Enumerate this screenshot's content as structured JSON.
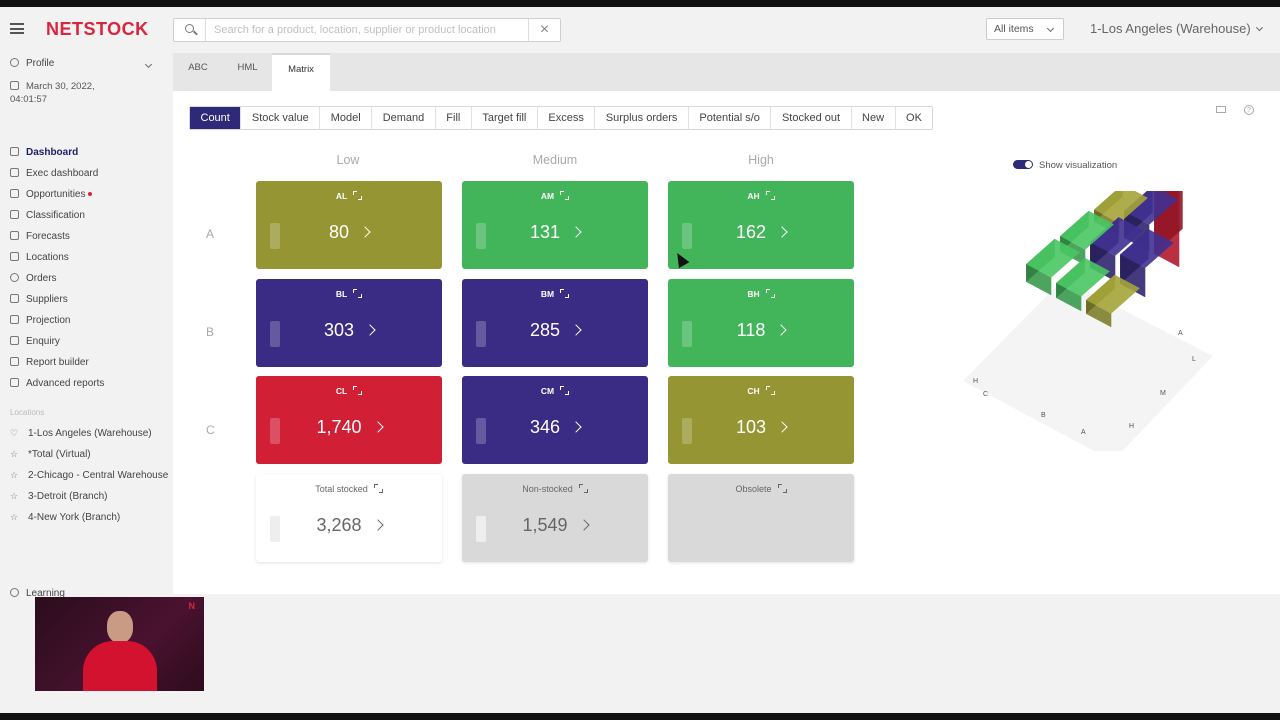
{
  "app": {
    "logo": "NETSTOCK",
    "search_placeholder": "Search for a product, location, supplier or product location",
    "items_filter": "All items",
    "location": "1-Los Angeles (Warehouse)"
  },
  "sidebar": {
    "profile": "Profile",
    "date": "March 30, 2022, 04:01:57",
    "nav": [
      {
        "label": "Dashboard",
        "icon": "chart-bars-icon"
      },
      {
        "label": "Exec dashboard",
        "icon": "grid-icon"
      },
      {
        "label": "Opportunities",
        "icon": "mountain-icon"
      },
      {
        "label": "Classification",
        "icon": "table-icon"
      },
      {
        "label": "Forecasts",
        "icon": "line-chart-icon"
      },
      {
        "label": "Locations",
        "icon": "building-icon"
      },
      {
        "label": "Orders",
        "icon": "orders-icon"
      },
      {
        "label": "Suppliers",
        "icon": "truck-icon"
      },
      {
        "label": "Projection",
        "icon": "projection-icon"
      },
      {
        "label": "Enquiry",
        "icon": "enquiry-icon"
      },
      {
        "label": "Report builder",
        "icon": "report-icon"
      },
      {
        "label": "Advanced reports",
        "icon": "document-icon"
      }
    ],
    "locations_title": "Locations",
    "locations": [
      "1-Los Angeles (Warehouse)",
      "*Total (Virtual)",
      "2-Chicago - Central Warehouse",
      "3-Detroit (Branch)",
      "4-New York (Branch)"
    ],
    "learning": "Learning"
  },
  "tabs": [
    "ABC",
    "HML",
    "Matrix"
  ],
  "metrics": [
    "Count",
    "Stock value",
    "Model",
    "Demand",
    "Fill",
    "Target fill",
    "Excess",
    "Surplus orders",
    "Potential s/o",
    "Stocked out",
    "New",
    "OK"
  ],
  "matrix": {
    "columns": [
      "Low",
      "Medium",
      "High"
    ],
    "rows": [
      "A",
      "B",
      "C"
    ],
    "cells": [
      {
        "code": "AL",
        "value": "80",
        "color": "#959533"
      },
      {
        "code": "AM",
        "value": "131",
        "color": "#42b55a"
      },
      {
        "code": "AH",
        "value": "162",
        "color": "#42b55a"
      },
      {
        "code": "BL",
        "value": "303",
        "color": "#3a2c84"
      },
      {
        "code": "BM",
        "value": "285",
        "color": "#3a2c84"
      },
      {
        "code": "BH",
        "value": "118",
        "color": "#42b55a"
      },
      {
        "code": "CL",
        "value": "1,740",
        "color": "#d11f36"
      },
      {
        "code": "CM",
        "value": "346",
        "color": "#3a2c84"
      },
      {
        "code": "CH",
        "value": "103",
        "color": "#959533"
      }
    ],
    "totals": [
      {
        "label": "Total stocked",
        "value": "3,268",
        "color": "#ffffff"
      },
      {
        "label": "Non-stocked",
        "value": "1,549",
        "color": "#d9d9d9"
      },
      {
        "label": "Obsolete",
        "value": "",
        "color": "#d9d9d9"
      }
    ]
  },
  "visualization": {
    "toggle_label": "Show visualization"
  }
}
